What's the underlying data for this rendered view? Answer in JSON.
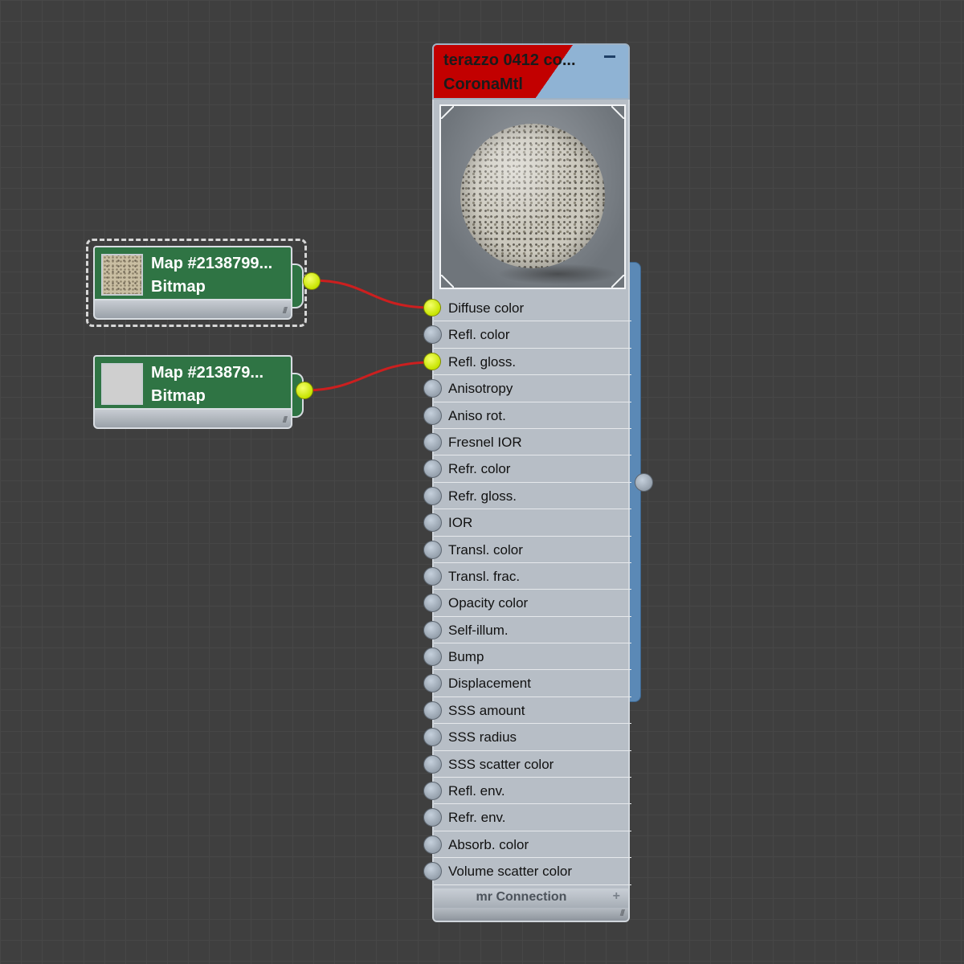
{
  "map_nodes": [
    {
      "title": "Map #2138799...",
      "subtitle": "Bitmap",
      "selected": true,
      "thumbnail": "terrazzo-texture"
    },
    {
      "title": "Map #213879...",
      "subtitle": "Bitmap",
      "selected": false,
      "thumbnail": "plain-grey"
    }
  ],
  "material": {
    "title": "terazzo 0412 co...",
    "subtitle": "CoronaMtl",
    "preview": "terrazzo-sphere",
    "slots": [
      {
        "label": "Diffuse color",
        "connected": true
      },
      {
        "label": "Refl. color",
        "connected": false
      },
      {
        "label": "Refl. gloss.",
        "connected": true
      },
      {
        "label": "Anisotropy",
        "connected": false
      },
      {
        "label": "Aniso rot.",
        "connected": false
      },
      {
        "label": "Fresnel IOR",
        "connected": false
      },
      {
        "label": "Refr. color",
        "connected": false
      },
      {
        "label": "Refr. gloss.",
        "connected": false
      },
      {
        "label": "IOR",
        "connected": false
      },
      {
        "label": "Transl. color",
        "connected": false
      },
      {
        "label": "Transl. frac.",
        "connected": false
      },
      {
        "label": "Opacity color",
        "connected": false
      },
      {
        "label": "Self-illum.",
        "connected": false
      },
      {
        "label": "Bump",
        "connected": false
      },
      {
        "label": "Displacement",
        "connected": false
      },
      {
        "label": "SSS amount",
        "connected": false
      },
      {
        "label": "SSS radius",
        "connected": false
      },
      {
        "label": "SSS scatter color",
        "connected": false
      },
      {
        "label": "Refl. env.",
        "connected": false
      },
      {
        "label": "Refr. env.",
        "connected": false
      },
      {
        "label": "Absorb. color",
        "connected": false
      },
      {
        "label": "Volume scatter color",
        "connected": false
      }
    ],
    "footer_label": "mr Connection"
  },
  "colors": {
    "canvas": "#3f3f3f",
    "map_header": "#2f7444",
    "material_accent": "#c20000",
    "wire": "#cc1f1f",
    "socket_connected": "#d4ee00"
  }
}
